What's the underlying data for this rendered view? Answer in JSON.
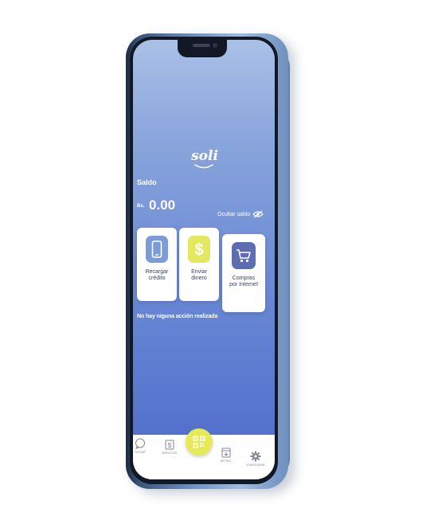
{
  "app": {
    "logo_text": "soli"
  },
  "balance": {
    "label": "Saldo",
    "currency": "Bs.",
    "amount": "0.00",
    "toggle_label": "Ocultar saldo"
  },
  "actions": [
    {
      "label": "Recargar\ncrédito",
      "icon": "phone-icon",
      "color": "#7d9bd6"
    },
    {
      "label": "Enviar\ndinero",
      "icon": "dollar-icon",
      "color": "#e4e85e"
    },
    {
      "label": "Compras\npor Internet",
      "icon": "cart-icon",
      "color": "#5d6db4"
    }
  ],
  "status_message": "No hay niguna acción realizada",
  "nav": {
    "items": [
      {
        "label": "HOGAR",
        "icon": "chat-bubble-icon"
      },
      {
        "label": "SERVICIOS",
        "icon": "dollar-box-icon"
      },
      {
        "label": "",
        "icon": "qr-code-icon"
      },
      {
        "label": "RETIRO",
        "icon": "download-box-icon"
      },
      {
        "label": "CONFIGURAR",
        "icon": "gear-icon"
      }
    ]
  },
  "colors": {
    "accent_yellow": "#e6ea56",
    "screen_blue": "#6f8dd6"
  }
}
